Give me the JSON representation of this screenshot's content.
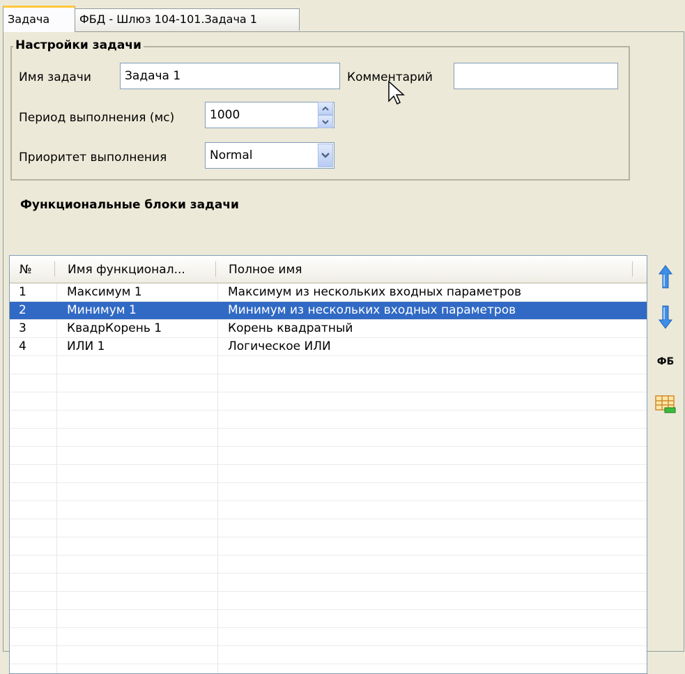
{
  "tabs": [
    {
      "label": "Задача",
      "active": true
    },
    {
      "label": "ФБД - Шлюз 104-101.Задача 1",
      "active": false
    }
  ],
  "settings": {
    "group_title": "Настройки задачи",
    "task_name_label": "Имя задачи",
    "task_name_value": "Задача 1",
    "comment_label": "Комментарий",
    "comment_value": "",
    "period_label": "Период выполнения (мс)",
    "period_value": "1000",
    "priority_label": "Приоритет выполнения",
    "priority_value": "Normal"
  },
  "blocks": {
    "title": "Функциональные блоки задачи",
    "columns": [
      "№",
      "Имя функционал...",
      "Полное имя"
    ],
    "rows": [
      {
        "num": "1",
        "name": "Максимум 1",
        "full": "Максимум из нескольких входных параметров",
        "selected": false
      },
      {
        "num": "2",
        "name": "Минимум 1",
        "full": "Минимум из нескольких входных параметров",
        "selected": true
      },
      {
        "num": "3",
        "name": "КвадрКорень 1",
        "full": "Корень квадратный",
        "selected": false
      },
      {
        "num": "4",
        "name": "ИЛИ 1",
        "full": "Логическое ИЛИ",
        "selected": false
      }
    ]
  },
  "toolbar": {
    "move_up_icon": "arrow-up-icon",
    "move_down_icon": "arrow-down-icon",
    "fb_label": "ФБ",
    "table_icon": "table-add-icon"
  },
  "colors": {
    "selection": "#316ac5",
    "tab_accent": "#ffc83c",
    "arrow": "#3c8ee8"
  }
}
